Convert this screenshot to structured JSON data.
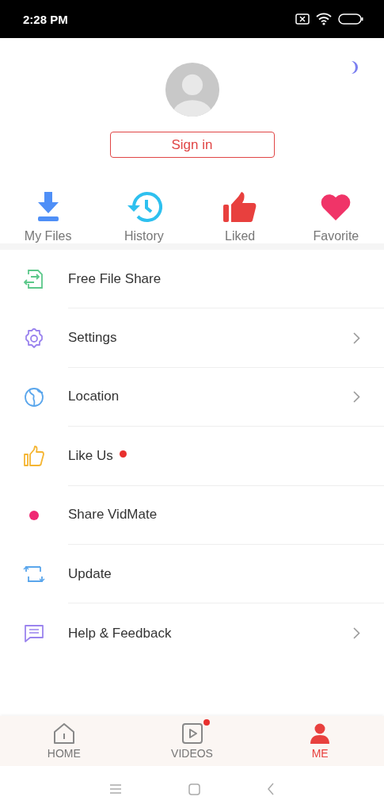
{
  "status_bar": {
    "time": "2:28 PM"
  },
  "profile": {
    "sign_in": "Sign in"
  },
  "shortcuts": [
    {
      "label": "My Files"
    },
    {
      "label": "History"
    },
    {
      "label": "Liked"
    },
    {
      "label": "Favorite"
    }
  ],
  "menu": [
    {
      "label": "Free File Share",
      "arrow": false,
      "badge": false
    },
    {
      "label": "Settings",
      "arrow": true,
      "badge": false
    },
    {
      "label": "Location",
      "arrow": true,
      "badge": false
    },
    {
      "label": "Like Us",
      "arrow": false,
      "badge": true
    },
    {
      "label": "Share VidMate",
      "arrow": false,
      "badge": false
    },
    {
      "label": "Update",
      "arrow": false,
      "badge": false
    },
    {
      "label": "Help & Feedback",
      "arrow": true,
      "badge": false
    }
  ],
  "tabs": [
    {
      "label": "HOME",
      "selected": false,
      "badge": false
    },
    {
      "label": "VIDEOS",
      "selected": false,
      "badge": true
    },
    {
      "label": "ME",
      "selected": true,
      "badge": false
    }
  ]
}
